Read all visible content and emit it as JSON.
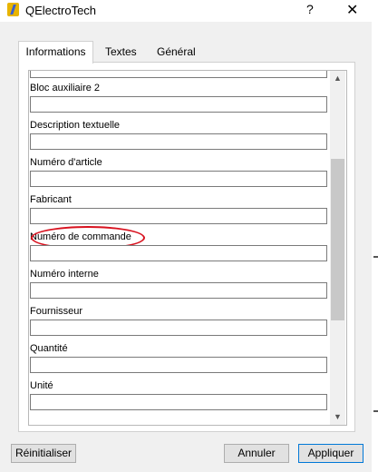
{
  "window": {
    "title": "QElectroTech",
    "help_label": "?",
    "close_label": "✕",
    "app_icon": "qelectrotech-icon"
  },
  "tabs": [
    {
      "label": "Informations",
      "active": true
    },
    {
      "label": "Textes",
      "active": false
    },
    {
      "label": "Général",
      "active": false
    }
  ],
  "fields": [
    {
      "label": "Bloc auxiliaire 2",
      "value": ""
    },
    {
      "label": "Description textuelle",
      "value": ""
    },
    {
      "label": "Numéro d'article",
      "value": ""
    },
    {
      "label": "Fabricant",
      "value": ""
    },
    {
      "label": "Numéro de commande",
      "value": "",
      "highlighted": true
    },
    {
      "label": "Numéro interne",
      "value": ""
    },
    {
      "label": "Fournisseur",
      "value": ""
    },
    {
      "label": "Quantité",
      "value": ""
    },
    {
      "label": "Unité",
      "value": ""
    }
  ],
  "scrollbar": {
    "position_fraction": 0.45,
    "thumb_fraction": 0.5
  },
  "highlight_color": "#d8121f",
  "buttons": {
    "reset": "Réinitialiser",
    "cancel": "Annuler",
    "apply": "Appliquer"
  }
}
